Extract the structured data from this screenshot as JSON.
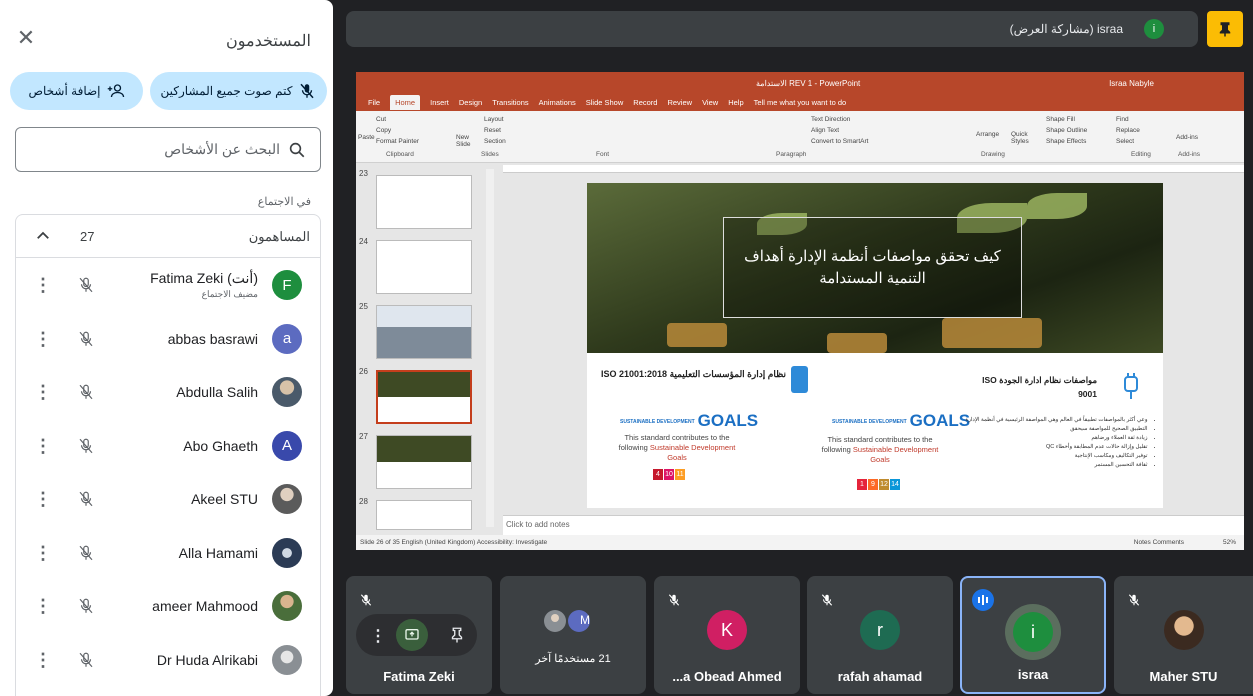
{
  "panel": {
    "title": "المستخدمون",
    "mute_all_label": "كتم صوت جميع المشاركين",
    "add_people_label": "إضافة أشخاص",
    "search_placeholder": "البحث عن الأشخاص",
    "section_label": "في الاجتماع",
    "contributors_title": "المساهمون",
    "contributors_count": "27",
    "participants": [
      {
        "name": "Fatima Zeki (أنت)",
        "sub": "مضيف الاجتماع",
        "initial": "F",
        "color": "#1e8e3e"
      },
      {
        "name": "abbas basrawi",
        "sub": "",
        "initial": "a",
        "color": "#5c6bc0"
      },
      {
        "name": "Abdulla Salih",
        "sub": "",
        "initial": "",
        "color": "#7a8a99"
      },
      {
        "name": "Abo Ghaeth",
        "sub": "",
        "initial": "A",
        "color": "#3949ab"
      },
      {
        "name": "Akeel STU",
        "sub": "",
        "initial": "",
        "color": "#6d6d6d"
      },
      {
        "name": "Alla Hamami",
        "sub": "",
        "initial": "",
        "color": "#2b3b55"
      },
      {
        "name": "ameer Mahmood",
        "sub": "",
        "initial": "",
        "color": "#8d7560"
      },
      {
        "name": "Dr Huda Alrikabi",
        "sub": "",
        "initial": "",
        "color": "#9aa0a6"
      }
    ]
  },
  "topbar": {
    "presenter_label": "israa (مشاركة العرض)",
    "presenter_initial": "i"
  },
  "ppt": {
    "window_title": "الاستدامة REV 1 - PowerPoint",
    "user": "Israa Nabyle",
    "tabs": [
      "File",
      "Home",
      "Insert",
      "Design",
      "Transitions",
      "Animations",
      "Slide Show",
      "Record",
      "Review",
      "View",
      "Help",
      "Tell me what you want to do"
    ],
    "ribbon_groups": [
      "Clipboard",
      "Slides",
      "Font",
      "Paragraph",
      "Drawing",
      "Editing",
      "Add-ins"
    ],
    "ribbon_items": [
      "Cut",
      "Copy",
      "Format Painter",
      "Paste",
      "New Slide",
      "Layout",
      "Reset",
      "Section",
      "Text Direction",
      "Align Text",
      "Convert to SmartArt",
      "Arrange",
      "Quick Styles",
      "Shape Fill",
      "Shape Outline",
      "Shape Effects",
      "Find",
      "Replace",
      "Select",
      "Add-ins"
    ],
    "slide_numbers": [
      "23",
      "24",
      "25",
      "26",
      "27",
      "28"
    ],
    "notes_placeholder": "Click to add notes",
    "status_left": "Slide 26 of 35     English (United Kingdom)     Accessibility: Investigate",
    "status_right": "Notes    Comments",
    "zoom": "52%",
    "slide": {
      "hero_line1": "كيف تحقق مواصفات أنظمة الإدارة أهداف",
      "hero_line2": "التنمية المستدامة",
      "left_title": "نظام إدارة المؤسسات التعليمية ISO 21001:2018",
      "right_title": "مواصفات نظام ادارة الجودة ISO 9001",
      "goals_small": "SUSTAINABLE DEVELOPMENT",
      "goals_word": "GOALS",
      "contrib_prefix": "This standard contributes to the following",
      "contrib_highlight": "Sustainable Development Goals",
      "left_sdgs": [
        "4",
        "10",
        "11"
      ],
      "right_sdgs": [
        "1",
        "9",
        "12",
        "14"
      ],
      "bullets": [
        "وعي أكثر بالمواصفات تطبيقاً في العالم وهي المواصفة الرئيسية في أنظمة الإدارة",
        "التطبيق الصحيح للمواصفة سيحقق",
        "زيادة ثقة العملاء ورضاهم",
        "تقليل وإزالة حالات عدم المطابقة وأخطاء QC",
        "توفير التكاليف ومكاسب الإنتاجية",
        "ثقافة التحسين المستمر"
      ]
    }
  },
  "tiles": {
    "self_name": "Fatima Zeki",
    "others_text": "21 مستخدمًا آخر",
    "others_initial": "M",
    "obead_name": "...a Obead Ahmed",
    "obead_initial": "K",
    "rafah_name": "rafah ahamad",
    "rafah_initial": "r",
    "israa_name": "israa",
    "israa_initial": "i",
    "maher_name": "Maher STU"
  },
  "colors": {
    "accent_pill": "#c2e7ff",
    "ppt_brand": "#b7472a",
    "presenter_green": "#1e8e3e",
    "tile_bg": "#3c4043",
    "pin_yellow": "#fbbc04"
  }
}
